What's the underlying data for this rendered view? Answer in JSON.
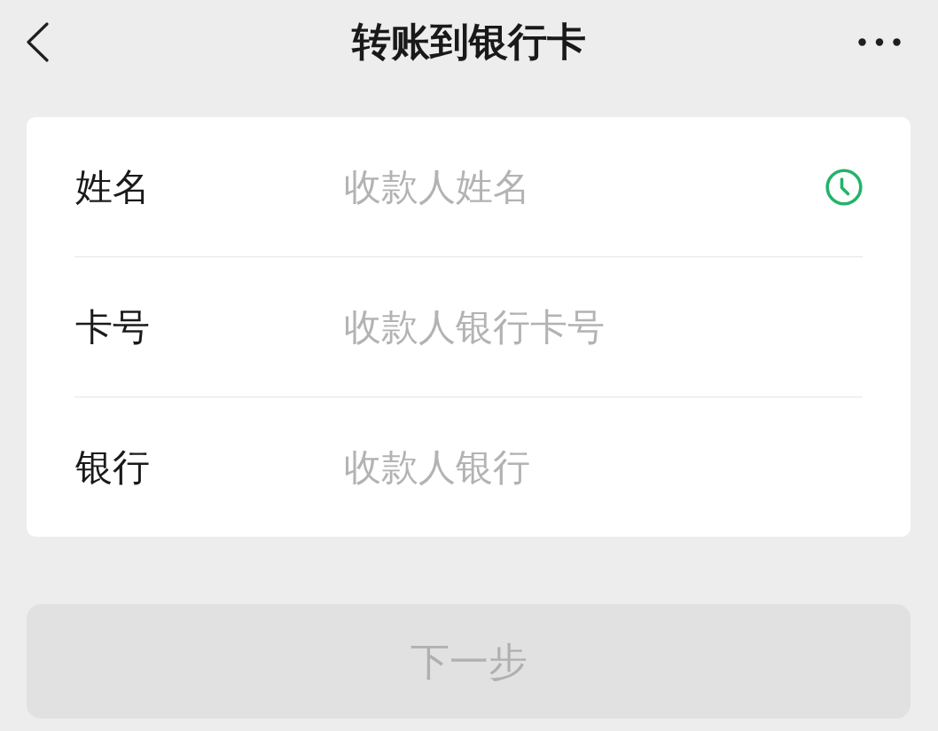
{
  "header": {
    "title": "转账到银行卡"
  },
  "form": {
    "fields": [
      {
        "label": "姓名",
        "placeholder": "收款人姓名",
        "kind": "history"
      },
      {
        "label": "卡号",
        "placeholder": "收款人银行卡号",
        "kind": "plain"
      },
      {
        "label": "银行",
        "placeholder": "收款人银行",
        "kind": "plain"
      }
    ]
  },
  "next_button": {
    "label": "下一步",
    "disabled": true
  }
}
